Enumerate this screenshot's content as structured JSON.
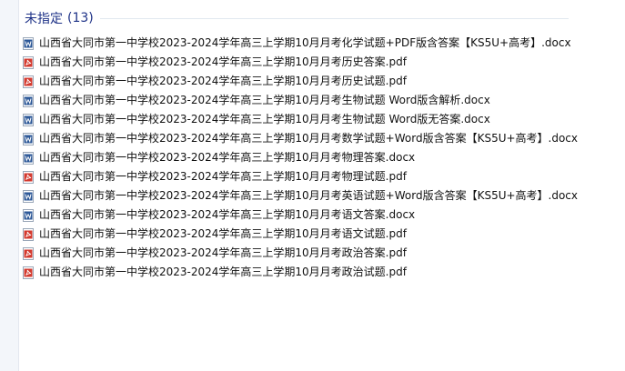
{
  "group": {
    "title": "未指定",
    "count": "(13)",
    "accent_color": "#1e3287"
  },
  "files": [
    {
      "name": "山西省大同市第一中学校2023-2024学年高三上学期10月月考化学试题+PDF版含答案【KS5U+高考】.docx",
      "icon": "word-document-icon"
    },
    {
      "name": "山西省大同市第一中学校2023-2024学年高三上学期10月月考历史答案.pdf",
      "icon": "pdf-document-icon"
    },
    {
      "name": "山西省大同市第一中学校2023-2024学年高三上学期10月月考历史试题.pdf",
      "icon": "pdf-document-icon"
    },
    {
      "name": "山西省大同市第一中学校2023-2024学年高三上学期10月月考生物试题  Word版含解析.docx",
      "icon": "word-document-icon"
    },
    {
      "name": "山西省大同市第一中学校2023-2024学年高三上学期10月月考生物试题  Word版无答案.docx",
      "icon": "word-document-icon"
    },
    {
      "name": "山西省大同市第一中学校2023-2024学年高三上学期10月月考数学试题+Word版含答案【KS5U+高考】.docx",
      "icon": "word-document-icon"
    },
    {
      "name": "山西省大同市第一中学校2023-2024学年高三上学期10月月考物理答案.docx",
      "icon": "word-document-icon"
    },
    {
      "name": "山西省大同市第一中学校2023-2024学年高三上学期10月月考物理试题.pdf",
      "icon": "pdf-document-icon"
    },
    {
      "name": "山西省大同市第一中学校2023-2024学年高三上学期10月月考英语试题+Word版含答案【KS5U+高考】.docx",
      "icon": "word-document-icon"
    },
    {
      "name": "山西省大同市第一中学校2023-2024学年高三上学期10月月考语文答案.docx",
      "icon": "word-document-icon"
    },
    {
      "name": "山西省大同市第一中学校2023-2024学年高三上学期10月月考语文试题.pdf",
      "icon": "pdf-document-icon"
    },
    {
      "name": "山西省大同市第一中学校2023-2024学年高三上学期10月月考政治答案.pdf",
      "icon": "pdf-document-icon"
    },
    {
      "name": "山西省大同市第一中学校2023-2024学年高三上学期10月月考政治试题.pdf",
      "icon": "pdf-document-icon"
    }
  ],
  "icon_colors": {
    "word": "#2b5797",
    "pdf": "#d33a2f"
  }
}
